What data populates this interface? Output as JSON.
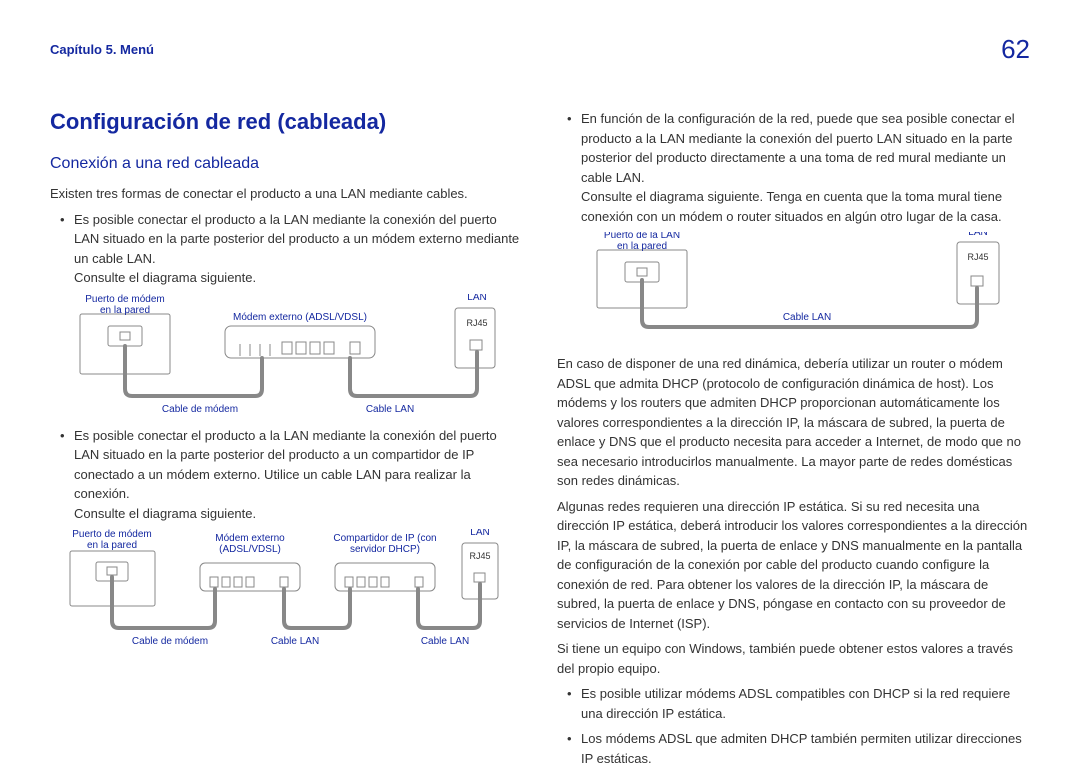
{
  "header": {
    "chapter": "Capítulo 5. Menú",
    "page": "62"
  },
  "left": {
    "title": "Configuración de red (cableada)",
    "subtitle": "Conexión a una red cableada",
    "intro": "Existen tres formas de conectar el producto a una LAN mediante cables.",
    "bullet1_a": "Es posible conectar el producto a la LAN mediante la conexión del puerto LAN situado en la parte posterior del producto a un módem externo mediante un cable LAN.",
    "bullet1_b": "Consulte el diagrama siguiente.",
    "bullet2_a": "Es posible conectar el producto a la LAN mediante la conexión del puerto LAN situado en la parte posterior del producto a un compartidor de IP conectado a un módem externo. Utilice un cable LAN para realizar la conexión.",
    "bullet2_b": "Consulte el diagrama siguiente."
  },
  "right": {
    "bullet3_a": "En función de la configuración de la red, puede que sea posible conectar el producto a la LAN mediante la conexión del puerto LAN situado en la parte posterior del producto directamente a una toma de red mural mediante un cable LAN.",
    "bullet3_b": "Consulte el diagrama siguiente. Tenga en cuenta que la toma mural tiene conexión con un módem o router situados en algún otro lugar de la casa.",
    "para1": "En caso de disponer de una red dinámica, debería utilizar un router o módem ADSL que admita DHCP (protocolo de configuración dinámica de host). Los módems y los routers que admiten DHCP proporcionan automáticamente los valores correspondientes a la dirección IP, la máscara de subred, la puerta de enlace y DNS que el producto necesita para acceder a Internet, de modo que no sea necesario introducirlos manualmente. La mayor parte de redes domésticas son redes dinámicas.",
    "para2": "Algunas redes requieren una dirección IP estática. Si su red necesita una dirección IP estática, deberá introducir los valores correspondientes a la dirección IP, la máscara de subred, la puerta de enlace y DNS manualmente en la pantalla de configuración de la conexión por cable del producto cuando configure la conexión de red. Para obtener los valores de la dirección IP, la máscara de subred, la puerta de enlace y DNS, póngase en contacto con su proveedor de servicios de Internet (ISP).",
    "para3": "Si tiene un equipo con Windows, también puede obtener estos valores a través del propio equipo.",
    "sub_bullet1": "Es posible utilizar módems ADSL compatibles con DHCP si la red requiere una dirección IP estática.",
    "sub_bullet2": "Los módems ADSL que admiten DHCP también permiten utilizar direcciones IP estáticas."
  },
  "labels": {
    "modem_port_wall": "Puerto de módem",
    "on_wall": "en la pared",
    "external_modem": "Módem externo (ADSL/VDSL)",
    "external_modem_short1": "Módem externo",
    "external_modem_short2": "(ADSL/VDSL)",
    "ip_sharer1": "Compartidor de IP (con",
    "ip_sharer2": "servidor DHCP)",
    "lan_port_wall": "Puerto de la LAN",
    "modem_cable": "Cable de módem",
    "lan_cable": "Cable LAN",
    "LAN": "LAN",
    "RJ45": "RJ45"
  }
}
